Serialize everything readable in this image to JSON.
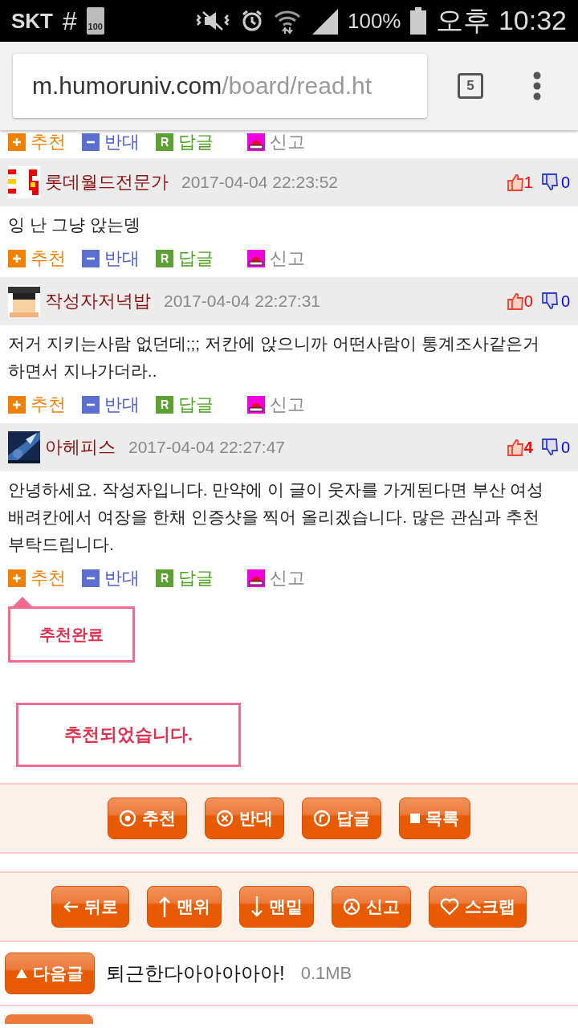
{
  "status_bar": {
    "carrier": "SKT",
    "network_mark": "#",
    "battery_badge": "100",
    "battery_percent": "100%",
    "time": "오후 10:32"
  },
  "browser": {
    "url_host": "m.humoruniv.com",
    "url_path": "/board/read.ht",
    "tab_count": "5"
  },
  "top_actions": [
    {
      "kind": "recommend",
      "label": "추천"
    },
    {
      "kind": "oppose",
      "label": "반대"
    },
    {
      "kind": "reply",
      "label": "답글"
    },
    {
      "kind": "report",
      "label": "신고"
    }
  ],
  "comments": [
    {
      "author": "롯데월드전문가",
      "date": "2017-04-04 22:23:52",
      "up": "1",
      "down": "0",
      "up_bold": false,
      "body": "잉 난 그냥 앉는뎅",
      "actions": [
        {
          "kind": "recommend",
          "label": "추천"
        },
        {
          "kind": "oppose",
          "label": "반대"
        },
        {
          "kind": "reply",
          "label": "답글"
        },
        {
          "kind": "report",
          "label": "신고"
        }
      ]
    },
    {
      "author": "작성자저녁밥",
      "date": "2017-04-04 22:27:31",
      "up": "0",
      "down": "0",
      "up_bold": false,
      "body": "저거 지키는사람 없던데;;; 저칸에 앉으니까 어떤사람이 통계조사같은거 하면서 지나가더라..",
      "actions": [
        {
          "kind": "recommend",
          "label": "추천"
        },
        {
          "kind": "oppose",
          "label": "반대"
        },
        {
          "kind": "reply",
          "label": "답글"
        },
        {
          "kind": "report",
          "label": "신고"
        }
      ]
    },
    {
      "author": "아헤피스",
      "date": "2017-04-04 22:27:47",
      "up": "4",
      "down": "0",
      "up_bold": true,
      "body": "안녕하세요. 작성자입니다. 만약에 이 글이 웃자를 가게된다면 부산 여성 배려칸에서 여장을 한채 인증샷을 찍어 올리겠습니다. 많은 관심과 추천 부탁드립니다.",
      "actions": [
        {
          "kind": "recommend",
          "label": "추천"
        },
        {
          "kind": "oppose",
          "label": "반대"
        },
        {
          "kind": "reply",
          "label": "답글"
        },
        {
          "kind": "report",
          "label": "신고"
        }
      ],
      "tooltip": "추천완료"
    }
  ],
  "notice": "추천되었습니다.",
  "button_panels": [
    {
      "buttons": [
        {
          "kind": "recommend",
          "label": "추천"
        },
        {
          "kind": "oppose",
          "label": "반대"
        },
        {
          "kind": "reply",
          "label": "답글"
        },
        {
          "kind": "list",
          "label": "목록"
        }
      ]
    },
    {
      "buttons": [
        {
          "kind": "back",
          "label": "뒤로"
        },
        {
          "kind": "top",
          "label": "맨위"
        },
        {
          "kind": "bottom",
          "label": "맨밑"
        },
        {
          "kind": "report",
          "label": "신고"
        },
        {
          "kind": "scrap",
          "label": "스크랩"
        }
      ]
    }
  ],
  "next_post": {
    "button": "다음글",
    "title": "퇴근한다아아아아아!",
    "size": "0.1MB"
  }
}
